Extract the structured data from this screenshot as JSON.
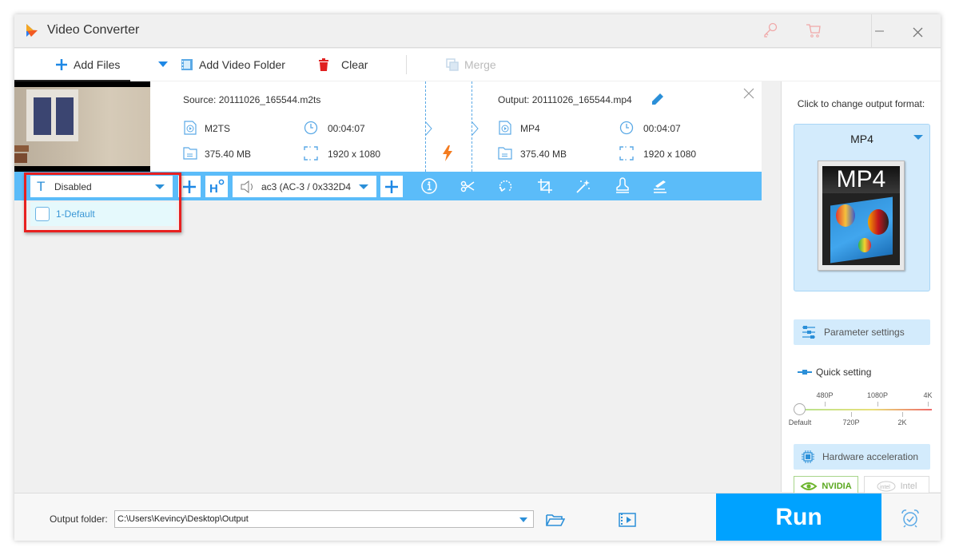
{
  "app": {
    "title": "Video Converter"
  },
  "titlebar": {
    "icons": [
      "key-icon",
      "cart-icon",
      "minimize-icon",
      "close-icon"
    ]
  },
  "toolbar": {
    "add_files": "Add Files",
    "add_video_folder": "Add Video Folder",
    "clear": "Clear",
    "merge": "Merge"
  },
  "file": {
    "source_label": "Source: 20111026_165544.m2ts",
    "source": {
      "format": "M2TS",
      "duration": "00:04:07",
      "size": "375.40 MB",
      "resolution": "1920 x 1080"
    },
    "output_label": "Output: 20111026_165544.mp4",
    "output": {
      "format": "MP4",
      "duration": "00:04:07",
      "size": "375.40 MB",
      "resolution": "1920 x 1080"
    }
  },
  "edit_bar": {
    "subtitle_value": "Disabled",
    "audio_value": "ac3 (AC-3 / 0x332D4",
    "icons": [
      "info-icon",
      "cut-icon",
      "rotate-icon",
      "crop-icon",
      "effects-icon",
      "watermark-icon",
      "subtitle-edit-icon"
    ]
  },
  "subtitle_dropdown": {
    "options": [
      {
        "label": "1-Default",
        "checked": false
      }
    ]
  },
  "right_panel": {
    "change_format_label": "Click to change output format:",
    "format": "MP4",
    "format_image_text": "MP4",
    "parameter_settings": "Parameter settings",
    "quick_setting": "Quick setting",
    "quality_top_ticks": [
      "480P",
      "1080P",
      "4K"
    ],
    "quality_bottom_ticks": [
      "Default",
      "720P",
      "2K"
    ],
    "quality_selected": "Default",
    "hardware_acceleration": "Hardware acceleration",
    "nvidia": "NVIDIA",
    "intel": "Intel"
  },
  "bottom": {
    "output_folder_label": "Output folder:",
    "output_folder_value": "C:\\Users\\Kevincy\\Desktop\\Output",
    "run": "Run"
  },
  "colors": {
    "accent": "#00a2ff",
    "bar": "#5bbcf9",
    "highlight": "#e8201f"
  }
}
